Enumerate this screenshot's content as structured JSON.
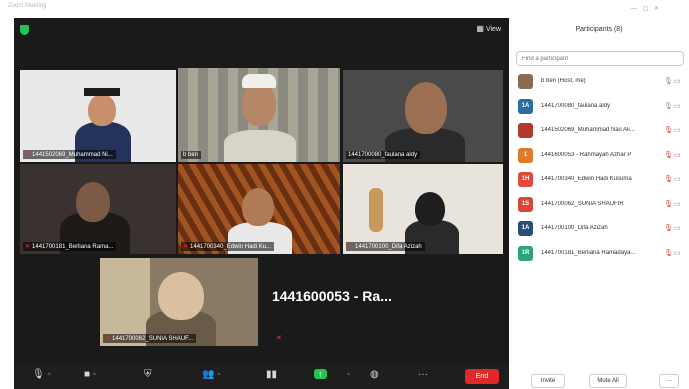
{
  "window": {
    "app_title": "Zoom Meeting",
    "view_label": "View",
    "colors": {
      "mic_muted": "#e83b3b",
      "active_speaker": "#cfe243",
      "share": "#23c552",
      "end": "#e02828"
    }
  },
  "tiles": [
    {
      "label": "1441502069_Muhammad Ni..."
    },
    {
      "label": "b ben"
    },
    {
      "label": "1441700080_faulana aldy"
    },
    {
      "label": "1441700181_Berliana Rama..."
    },
    {
      "label": "1441700340_Edwin Hadi Ku..."
    },
    {
      "label": "1441700100_Difa Azizah"
    },
    {
      "label": "1441700062_SUNIA SHAUF..."
    }
  ],
  "name_only_tile": {
    "name": "1441600053 - Ra..."
  },
  "toolbar": {
    "end_label": "End",
    "icons": [
      "microphone-icon",
      "video-camera-icon",
      "security-icon",
      "participants-icon",
      "polls-icon",
      "share-screen-icon",
      "record-icon",
      "more-icon"
    ]
  },
  "panel": {
    "title": "Participants (8)",
    "search_placeholder": "Find a participant",
    "participants": [
      {
        "name": "b ben (Host, me)",
        "initials": "",
        "avatar_color": "#8c6a55",
        "mic": "on",
        "cam": "on"
      },
      {
        "name": "1441700080_faulana aldy",
        "initials": "1A",
        "avatar_color": "#2b6ea3",
        "mic": "on",
        "cam": "on"
      },
      {
        "name": "1441502069_Muhammad Nas Ali...",
        "initials": "",
        "avatar_color": "#b03a2e",
        "mic": "muted",
        "cam": "on"
      },
      {
        "name": "1441600053 - Rahmayah Azhar P",
        "initials": "1",
        "avatar_color": "#e07b2b",
        "mic": "muted",
        "cam": "off"
      },
      {
        "name": "1441700340_Edwin Hadi Kusuma",
        "initials": "1H",
        "avatar_color": "#e04a3a",
        "mic": "muted",
        "cam": "on"
      },
      {
        "name": "1441700062_SUNIA SHAUFIR",
        "initials": "1S",
        "avatar_color": "#d9463a",
        "mic": "muted",
        "cam": "on"
      },
      {
        "name": "1441700100_Difa Azizah",
        "initials": "1A",
        "avatar_color": "#2b4e78",
        "mic": "muted",
        "cam": "on"
      },
      {
        "name": "1441700181_Berliana Ramadaya...",
        "initials": "1R",
        "avatar_color": "#2ea37a",
        "mic": "muted",
        "cam": "on"
      }
    ],
    "invite_label": "Invite",
    "mute_all_label": "Mute All",
    "more_label": "..."
  }
}
